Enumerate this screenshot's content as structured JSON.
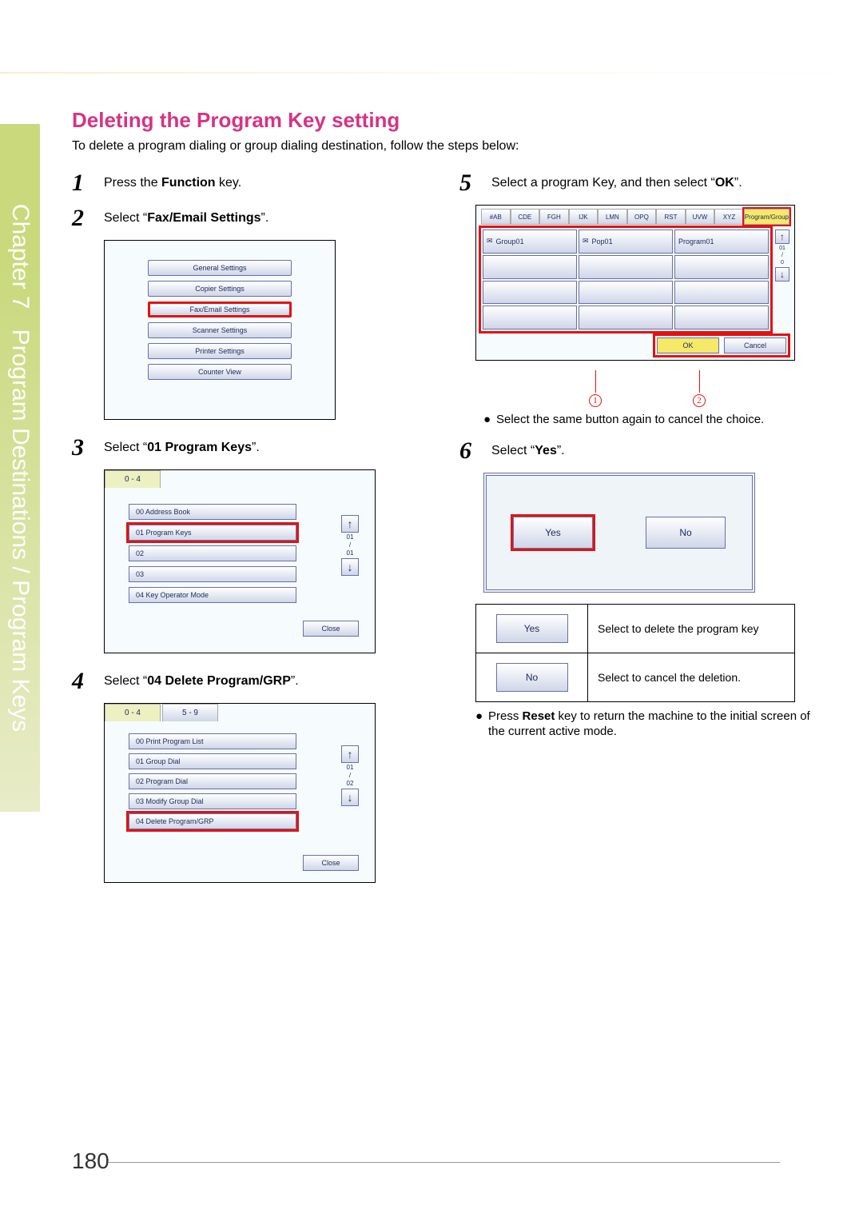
{
  "chapter": {
    "label": "Chapter 7",
    "title": "Program Destinations / Program Keys"
  },
  "heading": "Deleting the Program Key setting",
  "intro": "To delete a program dialing or group dialing destination, follow the steps below:",
  "col_left": {
    "step1": {
      "num": "1",
      "pre": "Press the ",
      "bold": "Function",
      "post": " key."
    },
    "step2": {
      "num": "2",
      "pre": "Select “",
      "bold": "Fax/Email Settings",
      "post": "”."
    },
    "step3": {
      "num": "3",
      "pre": "Select “",
      "bold": "01 Program Keys",
      "post": "”."
    },
    "step4": {
      "num": "4",
      "pre": "Select “",
      "bold": "04 Delete Program/GRP",
      "post": "”."
    }
  },
  "ss2": {
    "r1": "General Settings",
    "r2": "Copier Settings",
    "r3": "Fax/Email Settings",
    "r4": "Scanner Settings",
    "r5": "Printer Settings",
    "r6": "Counter View"
  },
  "ss3": {
    "tab": "0 - 4",
    "r0": "00  Address Book",
    "r1": "01  Program Keys",
    "r2": "02",
    "r3": "03",
    "r4": "04  Key Operator Mode",
    "page_top": "01",
    "page_mid": "/",
    "page_bot": "01",
    "close": "Close"
  },
  "ss4": {
    "tab1": "0 - 4",
    "tab2": "5 - 9",
    "r0": "00  Print Program List",
    "r1": "01  Group Dial",
    "r2": "02  Program Dial",
    "r3": "03  Modify Group Dial",
    "r4": "04  Delete Program/GRP",
    "page_top": "01",
    "page_mid": "/",
    "page_bot": "02",
    "close": "Close"
  },
  "col_right": {
    "step5": {
      "num": "5",
      "pre": "Select a program Key, and then select “",
      "bold": "OK",
      "post": "”."
    },
    "step6": {
      "num": "6",
      "pre": "Select “",
      "bold": "Yes",
      "post": "”."
    }
  },
  "ss5": {
    "tabs": {
      "t0": "#AB",
      "t1": "CDE",
      "t2": "FGH",
      "t3": "IJK",
      "t4": "LMN",
      "t5": "OPQ",
      "t6": "RST",
      "t7": "UVW",
      "t8": "XYZ",
      "t9": "Program/Group"
    },
    "c0": "Group01",
    "c1": "Pop01",
    "c2": "Program01",
    "page_top": "01",
    "page_mid": "/",
    "page_bot": "0",
    "ok": "OK",
    "cancel": "Cancel",
    "call1": "1",
    "call2": "2"
  },
  "note5": "Select the same button again to cancel the choice.",
  "ss6": {
    "yes": "Yes",
    "no": "No"
  },
  "explain": {
    "yes": "Yes",
    "yes_txt": "Select to delete the program key",
    "no": "No",
    "no_txt": "Select to cancel the deletion."
  },
  "note6_pre": "Press ",
  "note6_bold": "Reset",
  "note6_post": " key to return the machine to the initial screen of the current active mode.",
  "page_number": "180"
}
